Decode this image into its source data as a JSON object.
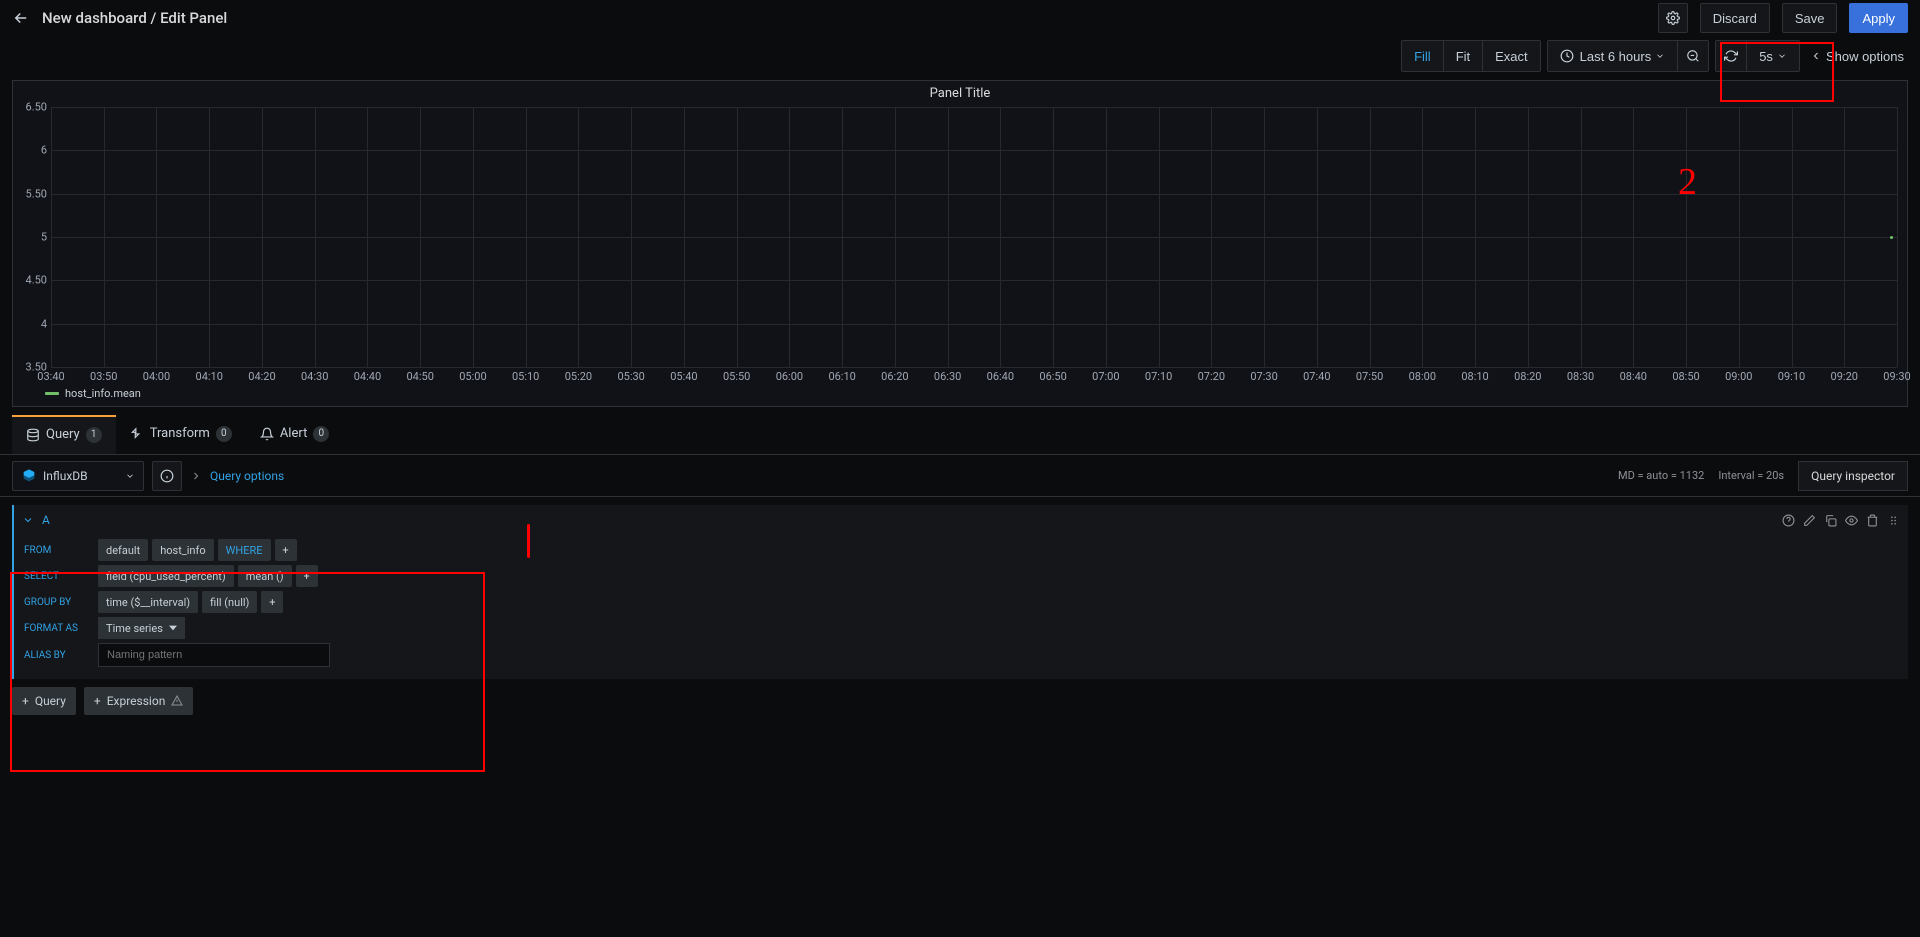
{
  "header": {
    "title": "New dashboard / Edit Panel",
    "discard": "Discard",
    "save": "Save",
    "apply": "Apply"
  },
  "toolbar": {
    "fill": "Fill",
    "fit": "Fit",
    "exact": "Exact",
    "timerange": "Last 6 hours",
    "refresh_interval": "5s",
    "show_options": "Show options"
  },
  "panel": {
    "title": "Panel Title",
    "legend": "host_info.mean"
  },
  "chart_data": {
    "type": "line",
    "title": "Panel Title",
    "xlabel": "",
    "ylabel": "",
    "ylim": [
      3.5,
      6.5
    ],
    "y_ticks": [
      3.5,
      4,
      4.5,
      5,
      5.5,
      6,
      6.5
    ],
    "y_tick_labels": [
      "3.50",
      "4",
      "4.50",
      "5",
      "5.50",
      "6",
      "6.50"
    ],
    "x_ticks": [
      "03:40",
      "03:50",
      "04:00",
      "04:10",
      "04:20",
      "04:30",
      "04:40",
      "04:50",
      "05:00",
      "05:10",
      "05:20",
      "05:30",
      "05:40",
      "05:50",
      "06:00",
      "06:10",
      "06:20",
      "06:30",
      "06:40",
      "06:50",
      "07:00",
      "07:10",
      "07:20",
      "07:30",
      "07:40",
      "07:50",
      "08:00",
      "08:10",
      "08:20",
      "08:30",
      "08:40",
      "08:50",
      "09:00",
      "09:10",
      "09:20",
      "09:30"
    ],
    "series": [
      {
        "name": "host_info.mean",
        "color": "#73bf69",
        "values": [
          {
            "x": "09:38",
            "y": 5.0
          }
        ]
      }
    ]
  },
  "tabs": {
    "query": {
      "label": "Query",
      "count": "1"
    },
    "transform": {
      "label": "Transform",
      "count": "0"
    },
    "alert": {
      "label": "Alert",
      "count": "0"
    }
  },
  "qopts": {
    "datasource": "InfluxDB",
    "options_label": "Query options",
    "md": "MD = auto = 1132",
    "interval": "Interval = 20s",
    "inspector": "Query inspector"
  },
  "query": {
    "name": "A",
    "from": {
      "label": "FROM",
      "policy": "default",
      "measurement": "host_info",
      "where": "WHERE"
    },
    "select": {
      "label": "SELECT",
      "field": "field (cpu_used_percent)",
      "agg": "mean ()"
    },
    "groupby": {
      "label": "GROUP BY",
      "time": "time ($__interval)",
      "fill": "fill (null)"
    },
    "format": {
      "label": "FORMAT AS",
      "value": "Time series"
    },
    "alias": {
      "label": "ALIAS BY",
      "placeholder": "Naming pattern"
    }
  },
  "bottom": {
    "query": "Query",
    "expression": "Expression"
  },
  "annotation": {
    "num": "2"
  }
}
